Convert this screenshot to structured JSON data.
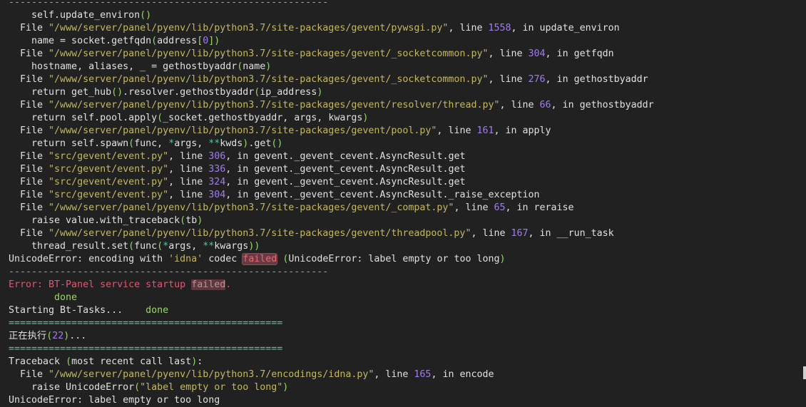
{
  "terminal": {
    "lines": [
      [
        {
          "t": "--------------------------------------------------------",
          "c": "sep"
        }
      ],
      [
        {
          "t": "    self.update_environ"
        },
        {
          "t": "()",
          "c": "par"
        }
      ],
      [
        {
          "t": "  File "
        },
        {
          "t": "\"/www/server/panel/pyenv/lib/python3.7/site-packages/gevent/pywsgi.py\"",
          "c": "str"
        },
        {
          "t": ", line "
        },
        {
          "t": "1558",
          "c": "num"
        },
        {
          "t": ", in update_environ"
        }
      ],
      [
        {
          "t": "    name = socket.getfqdn"
        },
        {
          "t": "(",
          "c": "par"
        },
        {
          "t": "address"
        },
        {
          "t": "[",
          "c": "par"
        },
        {
          "t": "0",
          "c": "num"
        },
        {
          "t": "])",
          "c": "par"
        }
      ],
      [
        {
          "t": "  File "
        },
        {
          "t": "\"/www/server/panel/pyenv/lib/python3.7/site-packages/gevent/_socketcommon.py\"",
          "c": "str"
        },
        {
          "t": ", line "
        },
        {
          "t": "304",
          "c": "num"
        },
        {
          "t": ", in getfqdn"
        }
      ],
      [
        {
          "t": "    hostname, aliases, _ = gethostbyaddr"
        },
        {
          "t": "(",
          "c": "par"
        },
        {
          "t": "name"
        },
        {
          "t": ")",
          "c": "par"
        }
      ],
      [
        {
          "t": "  File "
        },
        {
          "t": "\"/www/server/panel/pyenv/lib/python3.7/site-packages/gevent/_socketcommon.py\"",
          "c": "str"
        },
        {
          "t": ", line "
        },
        {
          "t": "276",
          "c": "num"
        },
        {
          "t": ", in gethostbyaddr"
        }
      ],
      [
        {
          "t": "    return get_hub"
        },
        {
          "t": "()",
          "c": "par"
        },
        {
          "t": ".resolver.gethostbyaddr"
        },
        {
          "t": "(",
          "c": "par"
        },
        {
          "t": "ip_address"
        },
        {
          "t": ")",
          "c": "par"
        }
      ],
      [
        {
          "t": "  File "
        },
        {
          "t": "\"/www/server/panel/pyenv/lib/python3.7/site-packages/gevent/resolver/thread.py\"",
          "c": "str"
        },
        {
          "t": ", line "
        },
        {
          "t": "66",
          "c": "num"
        },
        {
          "t": ", in gethostbyaddr"
        }
      ],
      [
        {
          "t": "    return self.pool.apply"
        },
        {
          "t": "(",
          "c": "par"
        },
        {
          "t": "_socket.gethostbyaddr, args, kwargs"
        },
        {
          "t": ")",
          "c": "par"
        }
      ],
      [
        {
          "t": "  File "
        },
        {
          "t": "\"/www/server/panel/pyenv/lib/python3.7/site-packages/gevent/pool.py\"",
          "c": "str"
        },
        {
          "t": ", line "
        },
        {
          "t": "161",
          "c": "num"
        },
        {
          "t": ", in apply"
        }
      ],
      [
        {
          "t": "    return self.spawn"
        },
        {
          "t": "(",
          "c": "par"
        },
        {
          "t": "func, "
        },
        {
          "t": "*",
          "c": "op"
        },
        {
          "t": "args, "
        },
        {
          "t": "**",
          "c": "op"
        },
        {
          "t": "kwds"
        },
        {
          "t": ")",
          "c": "par"
        },
        {
          "t": ".get"
        },
        {
          "t": "()",
          "c": "par"
        }
      ],
      [
        {
          "t": "  File "
        },
        {
          "t": "\"src/gevent/event.py\"",
          "c": "str"
        },
        {
          "t": ", line "
        },
        {
          "t": "306",
          "c": "num"
        },
        {
          "t": ", in gevent._gevent_cevent.AsyncResult.get"
        }
      ],
      [
        {
          "t": "  File "
        },
        {
          "t": "\"src/gevent/event.py\"",
          "c": "str"
        },
        {
          "t": ", line "
        },
        {
          "t": "336",
          "c": "num"
        },
        {
          "t": ", in gevent._gevent_cevent.AsyncResult.get"
        }
      ],
      [
        {
          "t": "  File "
        },
        {
          "t": "\"src/gevent/event.py\"",
          "c": "str"
        },
        {
          "t": ", line "
        },
        {
          "t": "324",
          "c": "num"
        },
        {
          "t": ", in gevent._gevent_cevent.AsyncResult.get"
        }
      ],
      [
        {
          "t": "  File "
        },
        {
          "t": "\"src/gevent/event.py\"",
          "c": "str"
        },
        {
          "t": ", line "
        },
        {
          "t": "304",
          "c": "num"
        },
        {
          "t": ", in gevent._gevent_cevent.AsyncResult._raise_exception"
        }
      ],
      [
        {
          "t": "  File "
        },
        {
          "t": "\"/www/server/panel/pyenv/lib/python3.7/site-packages/gevent/_compat.py\"",
          "c": "str"
        },
        {
          "t": ", line "
        },
        {
          "t": "65",
          "c": "num"
        },
        {
          "t": ", in reraise"
        }
      ],
      [
        {
          "t": "    raise value.with_traceback"
        },
        {
          "t": "(",
          "c": "par"
        },
        {
          "t": "tb"
        },
        {
          "t": ")",
          "c": "par"
        }
      ],
      [
        {
          "t": "  File "
        },
        {
          "t": "\"/www/server/panel/pyenv/lib/python3.7/site-packages/gevent/threadpool.py\"",
          "c": "str"
        },
        {
          "t": ", line "
        },
        {
          "t": "167",
          "c": "num"
        },
        {
          "t": ", in __run_task"
        }
      ],
      [
        {
          "t": "    thread_result.set"
        },
        {
          "t": "(",
          "c": "par"
        },
        {
          "t": "func"
        },
        {
          "t": "(",
          "c": "par"
        },
        {
          "t": "*",
          "c": "op"
        },
        {
          "t": "args, "
        },
        {
          "t": "**",
          "c": "op"
        },
        {
          "t": "kwargs"
        },
        {
          "t": "))",
          "c": "par"
        }
      ],
      [
        {
          "t": "UnicodeError: encoding with "
        },
        {
          "t": "'idna'",
          "c": "str"
        },
        {
          "t": " codec "
        },
        {
          "t": "failed",
          "c": "hl"
        },
        {
          "t": " "
        },
        {
          "t": "(",
          "c": "par"
        },
        {
          "t": "UnicodeError: label empty or too long"
        },
        {
          "t": ")",
          "c": "par"
        }
      ],
      [
        {
          "t": "--------------------------------------------------------",
          "c": "sep"
        }
      ],
      [
        {
          "t": "Error: BT-Panel service startup ",
          "c": "err"
        },
        {
          "t": "failed",
          "c": "hl2"
        },
        {
          "t": ".",
          "c": "err"
        }
      ],
      [
        {
          "t": "        done",
          "c": "ok"
        }
      ],
      [
        {
          "t": "Starting Bt-Tasks...    "
        },
        {
          "t": "done",
          "c": "ok"
        }
      ],
      [
        {
          "t": "================================================",
          "c": "sep"
        }
      ],
      [
        {
          "t": "正在执行"
        },
        {
          "t": "(",
          "c": "par"
        },
        {
          "t": "22",
          "c": "num"
        },
        {
          "t": ")",
          "c": "par"
        },
        {
          "t": "..."
        }
      ],
      [
        {
          "t": "================================================",
          "c": "sep"
        }
      ],
      [
        {
          "t": "Traceback "
        },
        {
          "t": "(",
          "c": "par"
        },
        {
          "t": "most recent call last"
        },
        {
          "t": ")",
          "c": "par"
        },
        {
          "t": ":"
        }
      ],
      [
        {
          "t": "  File "
        },
        {
          "t": "\"/www/server/panel/pyenv/lib/python3.7/encodings/idna.py\"",
          "c": "str"
        },
        {
          "t": ", line "
        },
        {
          "t": "165",
          "c": "num"
        },
        {
          "t": ", in encode"
        }
      ],
      [
        {
          "t": "    raise UnicodeError"
        },
        {
          "t": "(",
          "c": "par"
        },
        {
          "t": "\"label empty or too long\"",
          "c": "str"
        },
        {
          "t": ")",
          "c": "par"
        }
      ],
      [
        {
          "t": "UnicodeError: label empty or too long"
        }
      ]
    ]
  }
}
